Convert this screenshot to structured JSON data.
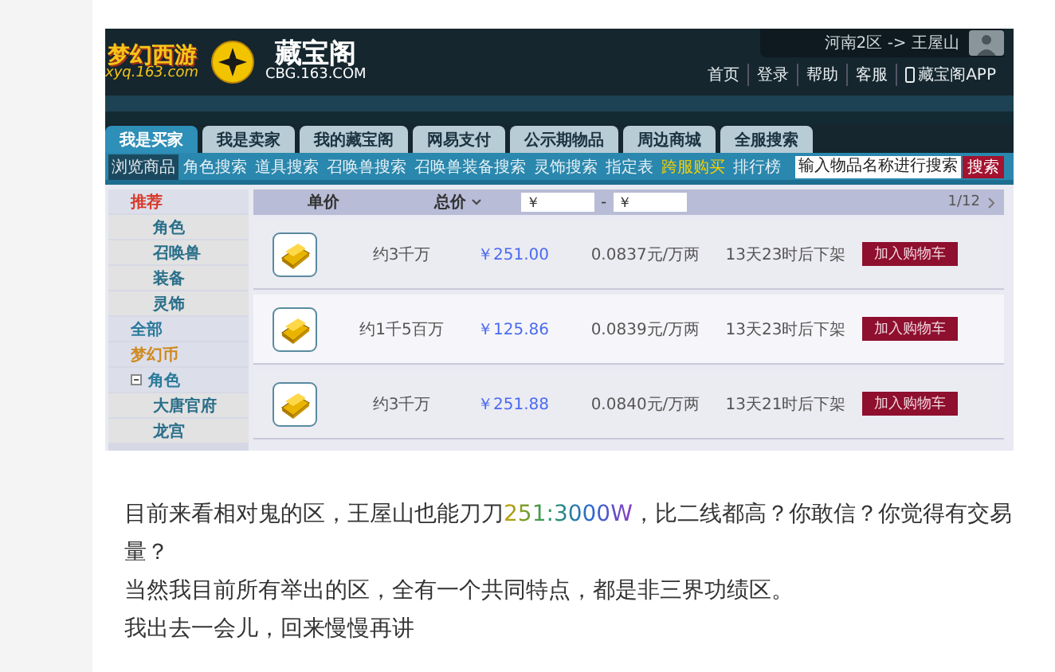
{
  "shot": {
    "logo": {
      "title": "梦幻西游",
      "site": "xyq.163.com",
      "brand": "藏宝阁",
      "domain": "CBG.163.COM"
    },
    "server": "河南2区 -> 王屋山",
    "top_links": [
      {
        "label": "首页",
        "kind": "text"
      },
      {
        "label": "登录",
        "kind": "text"
      },
      {
        "label": "帮助",
        "kind": "text"
      },
      {
        "label": "客服",
        "kind": "text"
      },
      {
        "label": "藏宝阁APP",
        "kind": "app"
      }
    ],
    "tabs": [
      {
        "label": "我是买家",
        "selected": true
      },
      {
        "label": "我是卖家",
        "selected": false
      },
      {
        "label": "我的藏宝阁",
        "selected": false
      },
      {
        "label": "网易支付",
        "selected": false
      },
      {
        "label": "公示期物品",
        "selected": false
      },
      {
        "label": "周边商城",
        "selected": false
      },
      {
        "label": "全服搜索",
        "selected": false
      }
    ],
    "subnav": [
      {
        "label": "浏览商品",
        "selected": true,
        "highlight": false
      },
      {
        "label": "角色搜索",
        "selected": false,
        "highlight": false
      },
      {
        "label": "道具搜索",
        "selected": false,
        "highlight": false
      },
      {
        "label": "召唤兽搜索",
        "selected": false,
        "highlight": false
      },
      {
        "label": "召唤兽装备搜索",
        "selected": false,
        "highlight": false
      },
      {
        "label": "灵饰搜索",
        "selected": false,
        "highlight": false
      },
      {
        "label": "指定表",
        "selected": false,
        "highlight": false
      },
      {
        "label": "跨服购买",
        "selected": false,
        "highlight": true
      },
      {
        "label": "排行榜",
        "selected": false,
        "highlight": false
      }
    ],
    "search": {
      "placeholder": "输入物品名称进行搜索",
      "button": "搜索"
    },
    "sidebar": [
      {
        "label": "推荐",
        "kind": "header",
        "color": "#d83a2a"
      },
      {
        "label": "角色",
        "kind": "sub"
      },
      {
        "label": "召唤兽",
        "kind": "sub"
      },
      {
        "label": "装备",
        "kind": "sub"
      },
      {
        "label": "灵饰",
        "kind": "sub"
      },
      {
        "label": "全部",
        "kind": "header",
        "color": "#2a7a9a"
      },
      {
        "label": "梦幻币",
        "kind": "header",
        "color": "#d08a20"
      },
      {
        "label": "角色",
        "kind": "group",
        "expanded": true,
        "color": "#2a7a9a",
        "children": [
          {
            "label": "大唐官府",
            "kind": "sub"
          },
          {
            "label": "龙宫",
            "kind": "sub"
          }
        ]
      }
    ],
    "table": {
      "columns": [
        "单价",
        "总价"
      ],
      "min_price": "￥",
      "dash": "-",
      "max_price": "￥",
      "page": "1/12",
      "rows": [
        {
          "total": "约3千万",
          "price": "￥251.00",
          "rate": "0.0837元/万两",
          "time": "13天23时后下架",
          "button": "加入购物车"
        },
        {
          "total": "约1千5百万",
          "price": "￥125.86",
          "rate": "0.0839元/万两",
          "time": "13天23时后下架",
          "button": "加入购物车"
        },
        {
          "total": "约3千万",
          "price": "￥251.88",
          "rate": "0.0840元/万两",
          "time": "13天21时后下架",
          "button": "加入购物车"
        }
      ]
    }
  },
  "post": [
    {
      "segments": [
        {
          "text": "目前来看相对鬼的区，王屋山也能刀刀",
          "colored": false
        },
        {
          "text": "251:3000W",
          "colored": true
        },
        {
          "text": "，比二线都高？你敢信？你觉得有交易量？",
          "colored": false
        }
      ]
    },
    {
      "segments": [
        {
          "text": "当然我目前所有举出的区，全有一个共同特点，都是非三界功绩区。",
          "colored": false
        }
      ]
    },
    {
      "segments": [
        {
          "text": "我出去一会儿，回来慢慢再讲",
          "colored": false
        }
      ]
    }
  ]
}
